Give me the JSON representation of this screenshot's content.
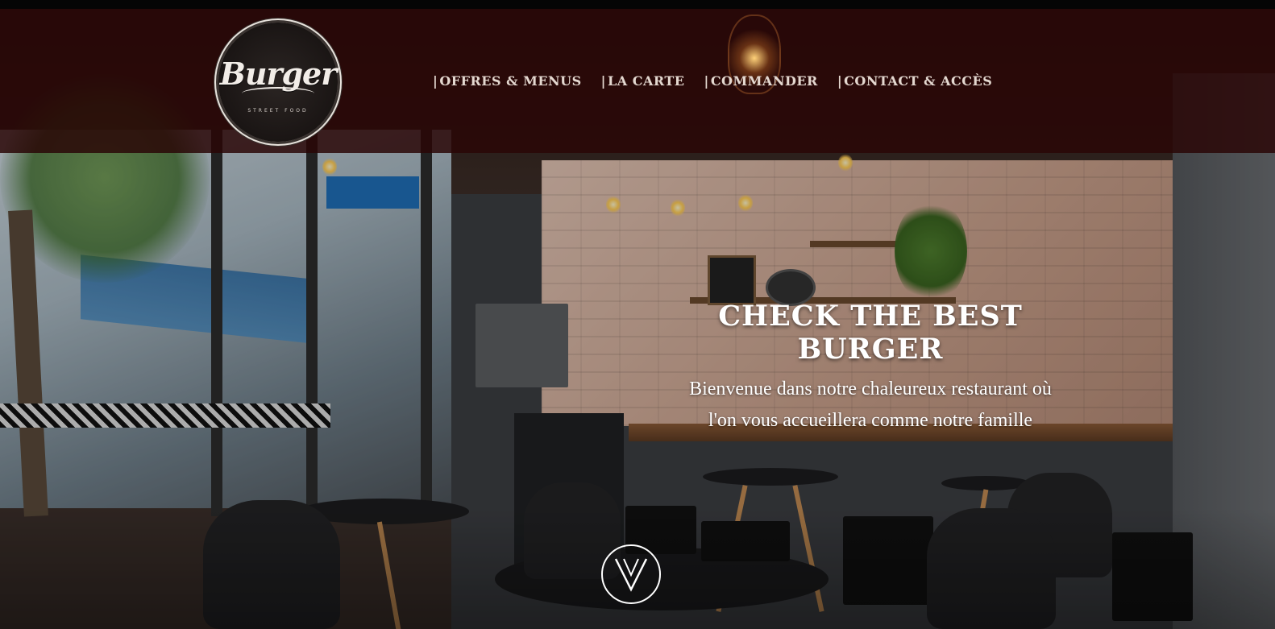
{
  "header": {
    "logo": {
      "wordmark": "Burger",
      "tagline": "STREET FOOD"
    },
    "nav": [
      {
        "separator": "|",
        "label": "OFFRES & MENUS"
      },
      {
        "separator": "|",
        "label": "LA CARTE"
      },
      {
        "separator": "|",
        "label": "COMMANDER"
      },
      {
        "separator": "|",
        "label": "CONTACT & ACCÈS"
      }
    ]
  },
  "hero": {
    "title": "CHECK THE BEST BURGER",
    "subtitle": "Bienvenue dans notre chaleureux restaurant où l'on vous accueillera comme notre famille",
    "scroll_icon": "chevron-down-icon"
  },
  "colors": {
    "header_overlay": "#280606",
    "nav_text": "#e4d8d0",
    "hero_text": "#ffffff"
  }
}
